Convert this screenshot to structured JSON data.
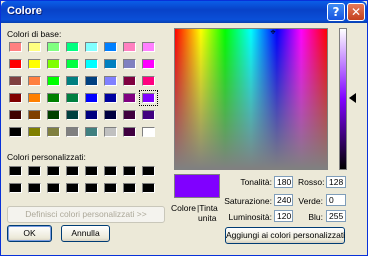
{
  "window": {
    "title": "Colore"
  },
  "titlebar": {
    "help_glyph": "?",
    "close_glyph": "✕"
  },
  "basic": {
    "label": "Colori di base:",
    "rows": [
      [
        "#ff8080",
        "#ffff80",
        "#80ff80",
        "#00ff80",
        "#80ffff",
        "#0080ff",
        "#ff80c0",
        "#ff80ff"
      ],
      [
        "#ff0000",
        "#ffff00",
        "#80ff00",
        "#00ff40",
        "#00ffff",
        "#0080c0",
        "#8080c0",
        "#ff00ff"
      ],
      [
        "#804040",
        "#ff8040",
        "#00ff00",
        "#008080",
        "#004080",
        "#8080ff",
        "#800040",
        "#ff0080"
      ],
      [
        "#800000",
        "#ff8000",
        "#008000",
        "#008040",
        "#0000ff",
        "#0000a0",
        "#800080",
        "#8000ff"
      ],
      [
        "#400000",
        "#804000",
        "#004000",
        "#004040",
        "#000080",
        "#000040",
        "#400040",
        "#400080"
      ],
      [
        "#000000",
        "#808000",
        "#808040",
        "#808080",
        "#408080",
        "#c0c0c0",
        "#400040",
        "#ffffff"
      ]
    ],
    "selected": [
      3,
      7
    ]
  },
  "custom": {
    "label": "Colori personalizzati:",
    "rows": [
      [
        "#000000",
        "#000000",
        "#000000",
        "#000000",
        "#000000",
        "#000000",
        "#000000",
        "#000000"
      ],
      [
        "#000000",
        "#000000",
        "#000000",
        "#000000",
        "#000000",
        "#000000",
        "#000000",
        "#000000"
      ]
    ]
  },
  "define_button": "Definisci colori personalizzati >>",
  "ok_button": "OK",
  "cancel_button": "Annulla",
  "preview": {
    "label_a": "Colore",
    "label_b": "|Tinta",
    "label_c": "unita",
    "color": "#8000ff"
  },
  "fields": {
    "hue": {
      "label": "Tonalità:",
      "value": "180"
    },
    "sat": {
      "label": "Saturazione:",
      "value": "240"
    },
    "lum": {
      "label": "Luminosità:",
      "value": "120"
    },
    "red": {
      "label": "Rosso:",
      "value": "128"
    },
    "green": {
      "label": "Verde:",
      "value": "0"
    },
    "blue": {
      "label": "Blu:",
      "value": "255"
    }
  },
  "add_button": "Aggiungi ai colori personalizzati",
  "spectrum": {
    "crosshair_glyph": "⌖"
  }
}
